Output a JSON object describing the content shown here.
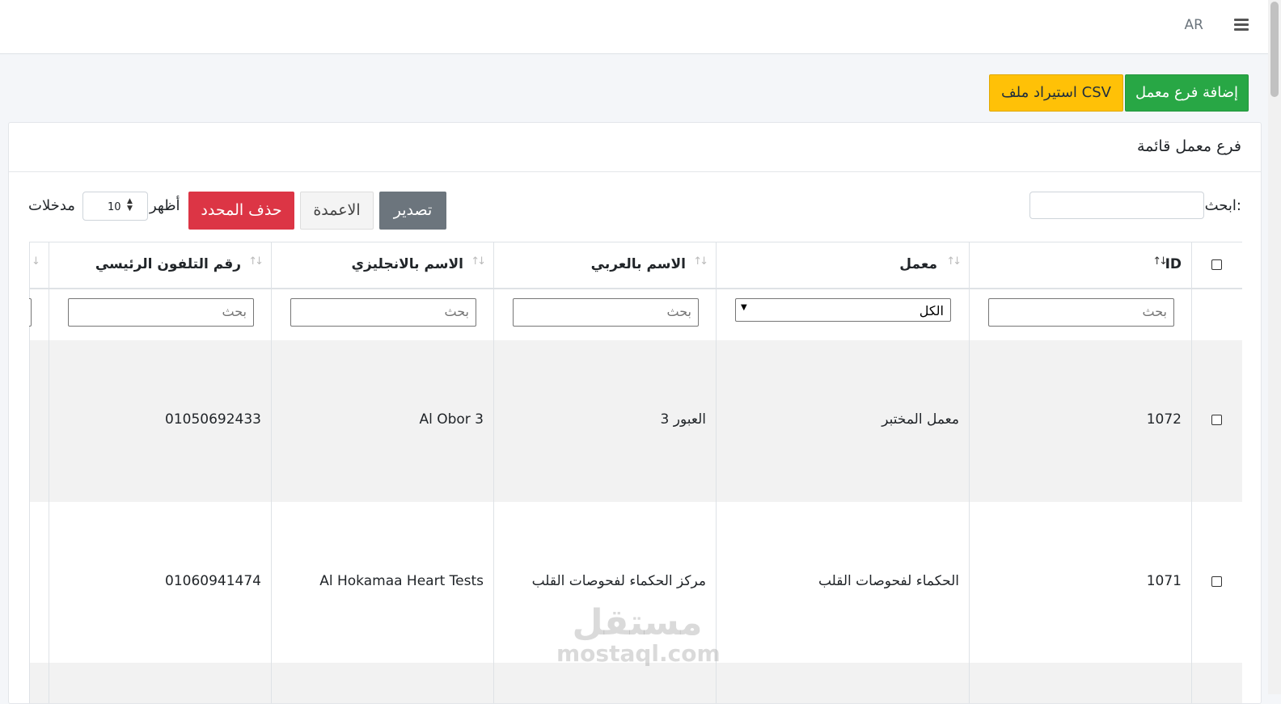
{
  "topbar": {
    "lang": "AR",
    "menu_icon": "hamburger-icon"
  },
  "actions": {
    "add_branch": "إضافة فرع معمل",
    "import_csv": "استيراد ملف CSV"
  },
  "card": {
    "title": "فرع معمل قائمة"
  },
  "toolbar": {
    "search_label": "ابحث:",
    "search_value": "",
    "export": "تصدير",
    "columns": "الاعمدة",
    "delete_selected": "حذف المحدد",
    "show": "أظهر",
    "entries": "مدخلات",
    "page_length": "10"
  },
  "table": {
    "headers": [
      "ID",
      "معمل",
      "الاسم بالعربي",
      "الاسم بالانجليزي",
      "رقم التلفون الرئيسي"
    ],
    "filters": {
      "placeholder": "بحث",
      "lab_select": "الكل"
    },
    "rows": [
      {
        "id": "1072",
        "lab": "معمل المختبر",
        "name_ar": "العبور 3",
        "name_en": "Al Obor 3",
        "phone": "01050692433"
      },
      {
        "id": "1071",
        "lab": "الحكماء لفحوصات القلب",
        "name_ar": "مركز الحكماء لفحوصات القلب",
        "name_en": "Al Hokamaa Heart Tests",
        "phone": "01060941474"
      }
    ]
  },
  "watermark": {
    "line1": "مستقل",
    "line2": "mostaql.com"
  }
}
